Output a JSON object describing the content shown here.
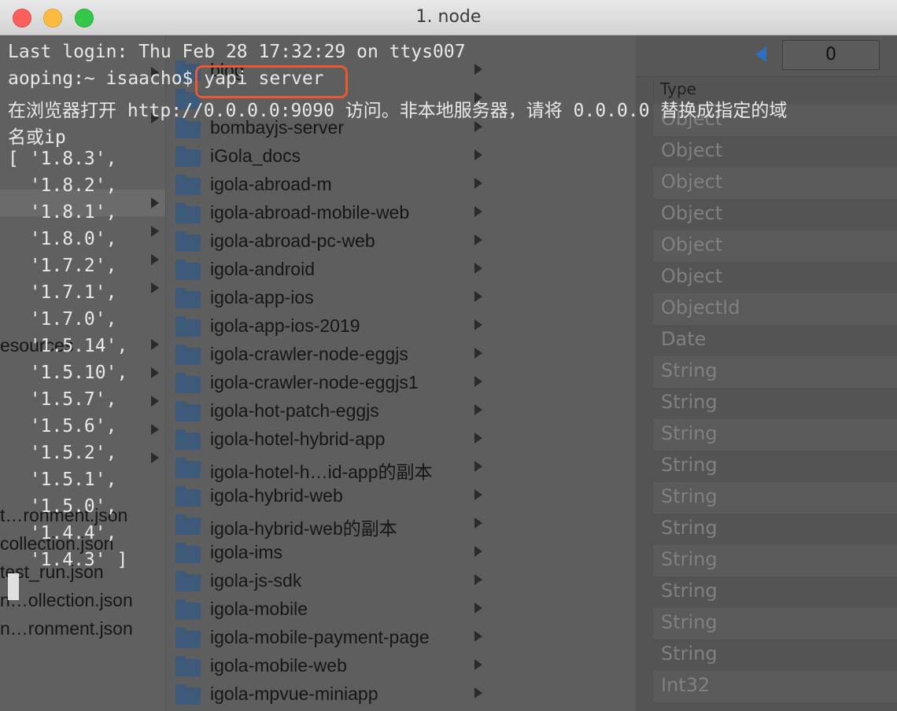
{
  "window": {
    "title": "1. node"
  },
  "terminal": {
    "lines": [
      "Last login: Thu Feb 28 17:32:29 on ttys007",
      "aoping:~ isaacho$ yapi server",
      "在浏览器打开 http://0.0.0.0:9090 访问。非本地服务器，请将 0.0.0.0 替换成指定的域",
      "名或ip",
      "[ '1.8.3',",
      "  '1.8.2',",
      "  '1.8.1',",
      "  '1.8.0',",
      "  '1.7.2',",
      "  '1.7.1',",
      "  '1.7.0',",
      "  '1.5.14',",
      "  '1.5.10',",
      "  '1.5.7',",
      "  '1.5.6',",
      "  '1.5.2',",
      "  '1.5.1',",
      "  '1.5.0',",
      "  '1.4.4',",
      "  '1.4.3' ]"
    ]
  },
  "finder": {
    "left_files": [
      "esources",
      "t…ronment.json",
      "collection.json",
      "test_run.json",
      "n…ollection.json",
      "n…ronment.json"
    ],
    "folders": [
      "blog",
      "",
      "bombayjs-server",
      "iGola_docs",
      "igola-abroad-m",
      "igola-abroad-mobile-web",
      "igola-abroad-pc-web",
      "igola-android",
      "igola-app-ios",
      "igola-app-ios-2019",
      "igola-crawler-node-eggjs",
      "igola-crawler-node-eggjs1",
      "igola-hot-patch-eggjs",
      "igola-hotel-hybrid-app",
      "igola-hotel-h…id-app的副本",
      "igola-hybrid-web",
      "igola-hybrid-web的副本",
      "igola-ims",
      "igola-js-sdk",
      "igola-mobile",
      "igola-mobile-payment-page",
      "igola-mobile-web",
      "igola-mpvue-miniapp"
    ]
  },
  "inspector": {
    "page_value": "0",
    "column_header": "Type",
    "types": [
      "Object",
      "Object",
      "Object",
      "Object",
      "Object",
      "Object",
      "ObjectId",
      "Date",
      "String",
      "String",
      "String",
      "String",
      "String",
      "String",
      "String",
      "String",
      "String",
      "String",
      "Int32"
    ]
  },
  "colors": {
    "highlight": "#ea5a2c",
    "folder": "#3d5a7a"
  }
}
